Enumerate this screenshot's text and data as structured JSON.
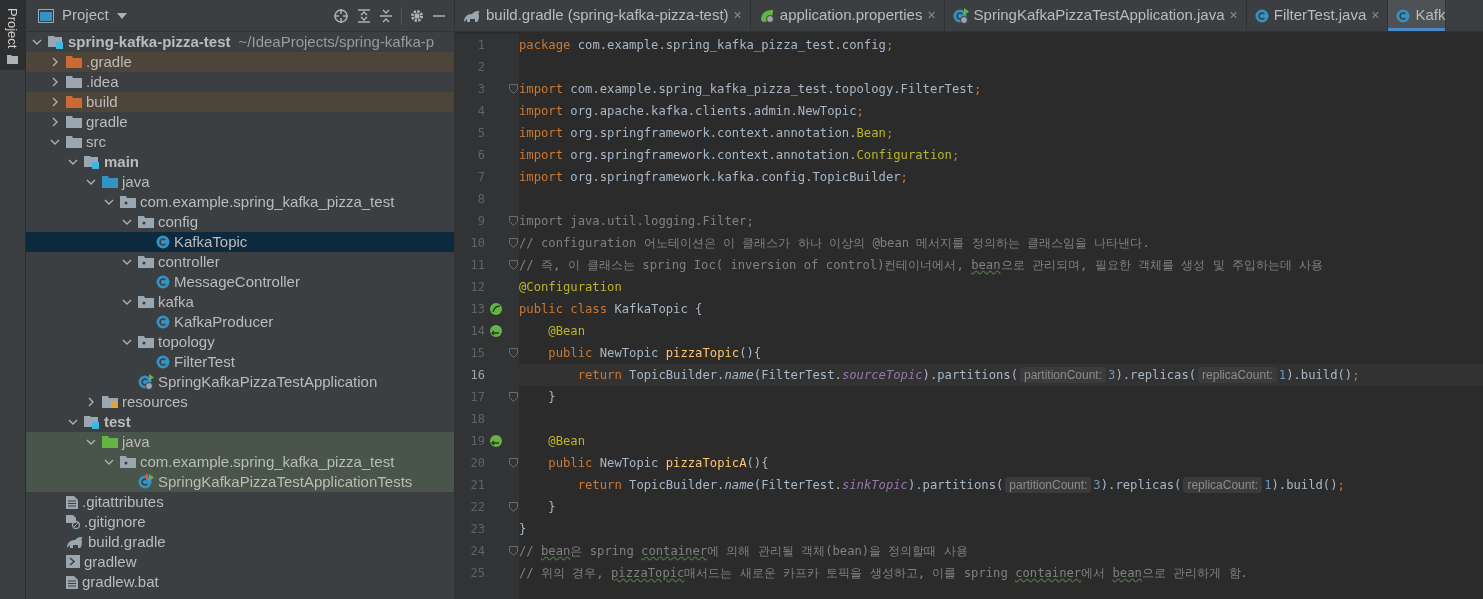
{
  "side_strip": {
    "label": "Project"
  },
  "project_panel": {
    "title": "Project",
    "tree": [
      {
        "label": "spring-kafka-pizza-test",
        "path": "~/IdeaProjects/spring-kafka-p",
        "kind": "module",
        "bold": true,
        "expanded": true,
        "selected": false,
        "children": [
          {
            "label": ".gradle",
            "kind": "excluded-folder",
            "expanded": false,
            "selected": false
          },
          {
            "label": ".idea",
            "kind": "folder",
            "expanded": false,
            "selected": false
          },
          {
            "label": "build",
            "kind": "excluded-folder",
            "expanded": false,
            "selected": false
          },
          {
            "label": "gradle",
            "kind": "folder",
            "expanded": false,
            "selected": false
          },
          {
            "label": "src",
            "kind": "folder",
            "expanded": true,
            "selected": false,
            "children": [
              {
                "label": "main",
                "kind": "module",
                "bold": true,
                "expanded": true,
                "selected": false,
                "children": [
                  {
                    "label": "java",
                    "kind": "source-folder",
                    "expanded": true,
                    "selected": false,
                    "children": [
                      {
                        "label": "com.example.spring_kafka_pizza_test",
                        "kind": "package",
                        "expanded": true,
                        "selected": false,
                        "children": [
                          {
                            "label": "config",
                            "kind": "package",
                            "expanded": true,
                            "selected": false,
                            "children": [
                              {
                                "label": "KafkaTopic",
                                "kind": "class",
                                "selected": true
                              }
                            ]
                          },
                          {
                            "label": "controller",
                            "kind": "package",
                            "expanded": true,
                            "selected": false,
                            "children": [
                              {
                                "label": "MessageController",
                                "kind": "class",
                                "selected": false
                              }
                            ]
                          },
                          {
                            "label": "kafka",
                            "kind": "package",
                            "expanded": true,
                            "selected": false,
                            "children": [
                              {
                                "label": "KafkaProducer",
                                "kind": "class",
                                "selected": false
                              }
                            ]
                          },
                          {
                            "label": "topology",
                            "kind": "package",
                            "expanded": true,
                            "selected": false,
                            "children": [
                              {
                                "label": "FilterTest",
                                "kind": "class",
                                "selected": false
                              }
                            ]
                          },
                          {
                            "label": "SpringKafkaPizzaTestApplication",
                            "kind": "application",
                            "selected": false
                          }
                        ]
                      }
                    ]
                  },
                  {
                    "label": "resources",
                    "kind": "resources",
                    "expanded": false,
                    "selected": false
                  }
                ]
              },
              {
                "label": "test",
                "kind": "module",
                "bold": true,
                "expanded": true,
                "selected": false,
                "children": [
                  {
                    "label": "java",
                    "kind": "test-folder",
                    "expanded": true,
                    "selected": false,
                    "children": [
                      {
                        "label": "com.example.spring_kafka_pizza_test",
                        "kind": "test-package",
                        "expanded": true,
                        "selected": false,
                        "children": [
                          {
                            "label": "SpringKafkaPizzaTestApplicationTests",
                            "kind": "test-class",
                            "selected": false
                          }
                        ]
                      }
                    ]
                  }
                ]
              }
            ]
          },
          {
            "label": ".gitattributes",
            "kind": "file",
            "selected": false
          },
          {
            "label": ".gitignore",
            "kind": "ignore-file",
            "selected": false
          },
          {
            "label": "build.gradle",
            "kind": "gradle",
            "selected": false
          },
          {
            "label": "gradlew",
            "kind": "shell",
            "selected": false
          },
          {
            "label": "gradlew.bat",
            "kind": "file",
            "selected": false
          }
        ]
      }
    ]
  },
  "tabs": [
    {
      "label": "build.gradle (spring-kafka-pizza-test)",
      "kind": "gradle",
      "close": "×",
      "selected": false
    },
    {
      "label": "application.properties",
      "kind": "properties",
      "close": "×",
      "selected": false
    },
    {
      "label": "SpringKafkaPizzaTestApplication.java",
      "kind": "application",
      "close": "×",
      "selected": false
    },
    {
      "label": "FilterTest.java",
      "kind": "class",
      "close": "×",
      "selected": false
    },
    {
      "label": "Kafk",
      "kind": "class",
      "selected": true
    }
  ],
  "editor": {
    "lines": [
      {
        "number": "1",
        "tokens": [
          {
            "kind": "keyword",
            "text": "package"
          },
          {
            "kind": "plain",
            "text": " com.example.spring_kafka_pizza_test.config"
          },
          {
            "kind": "keyword",
            "text": ";"
          }
        ]
      },
      {
        "number": "2"
      },
      {
        "number": "3",
        "fold": true,
        "tokens": [
          {
            "kind": "keyword",
            "text": "import"
          },
          {
            "kind": "plain",
            "text": " com.example.spring_kafka_pizza_test.topology.FilterTest"
          },
          {
            "kind": "keyword",
            "text": ";"
          }
        ]
      },
      {
        "number": "4",
        "tokens": [
          {
            "kind": "keyword",
            "text": "import"
          },
          {
            "kind": "plain",
            "text": " org.apache.kafka.clients.admin.NewTopic"
          },
          {
            "kind": "keyword",
            "text": ";"
          }
        ]
      },
      {
        "number": "5",
        "tokens": [
          {
            "kind": "keyword",
            "text": "import"
          },
          {
            "kind": "plain",
            "text": " org.springframework.context.annotation."
          },
          {
            "kind": "annotation",
            "text": "Bean"
          },
          {
            "kind": "keyword",
            "text": ";"
          }
        ]
      },
      {
        "number": "6",
        "tokens": [
          {
            "kind": "keyword",
            "text": "import"
          },
          {
            "kind": "plain",
            "text": " org.springframework.context.annotation."
          },
          {
            "kind": "annotation",
            "text": "Configuration"
          },
          {
            "kind": "keyword",
            "text": ";"
          }
        ]
      },
      {
        "number": "7",
        "tokens": [
          {
            "kind": "keyword",
            "text": "import"
          },
          {
            "kind": "plain",
            "text": " org.springframework.kafka.config.TopicBuilder"
          },
          {
            "kind": "keyword",
            "text": ";"
          }
        ]
      },
      {
        "number": "8"
      },
      {
        "number": "9",
        "fold": true,
        "tokens": [
          {
            "kind": "comment",
            "text": "import java.util.logging.Filter;"
          }
        ]
      },
      {
        "number": "10",
        "fold": true,
        "tokens": [
          {
            "kind": "comment",
            "text": "// configuration 어노테이션은 이 클래스가 하나 이상의 @bean 메서지를 정의하는 클래스임을 나타낸다."
          }
        ]
      },
      {
        "number": "11",
        "fold": true,
        "tokens": [
          {
            "kind": "comment",
            "text": "// 즉, 이 클래스는 spring Ioc( inversion of control)컨테이너에서, "
          },
          {
            "kind": "typo",
            "text": "bean"
          },
          {
            "kind": "comment",
            "text": "으로 관리되며, 필요한 객체를 생성 및 주입하는데 사용"
          }
        ]
      },
      {
        "number": "12",
        "tokens": [
          {
            "kind": "annotation",
            "text": "@Configuration"
          }
        ]
      },
      {
        "number": "13",
        "gutter": {
          "kind": "bean"
        },
        "tokens": [
          {
            "kind": "keyword",
            "text": "public class "
          },
          {
            "kind": "plain",
            "text": "KafkaTopic {"
          }
        ]
      },
      {
        "number": "14",
        "gutter": {
          "kind": "bean-link"
        },
        "tokens": [
          {
            "kind": "annotation",
            "text": "    @Bean"
          }
        ]
      },
      {
        "number": "15",
        "fold": true,
        "tokens": [
          {
            "kind": "keyword",
            "text": "    public "
          },
          {
            "kind": "plain",
            "text": "NewTopic "
          },
          {
            "kind": "method",
            "text": "pizzaTopic"
          },
          {
            "kind": "plain",
            "text": "(){"
          }
        ]
      },
      {
        "number": "16",
        "current": true,
        "tokens": [
          {
            "kind": "keyword",
            "text": "        return "
          },
          {
            "kind": "plain",
            "text": "TopicBuilder."
          },
          {
            "kind": "italic",
            "text": "name"
          },
          {
            "kind": "plain",
            "text": "(FilterTest."
          },
          {
            "kind": "static",
            "text": "sourceTopic"
          },
          {
            "kind": "plain",
            "text": ").partitions("
          },
          {
            "kind": "hint",
            "text": "partitionCount:"
          },
          {
            "kind": "number",
            "text": "3"
          },
          {
            "kind": "plain",
            "text": ").replicas("
          },
          {
            "kind": "hint",
            "text": "replicaCount:"
          },
          {
            "kind": "number",
            "text": "1"
          },
          {
            "kind": "plain",
            "text": ").build()"
          },
          {
            "kind": "keyword",
            "text": ";"
          }
        ]
      },
      {
        "number": "17",
        "fold": true,
        "tokens": [
          {
            "kind": "plain",
            "text": "    }"
          }
        ]
      },
      {
        "number": "18"
      },
      {
        "number": "19",
        "gutter": {
          "kind": "bean-link"
        },
        "tokens": [
          {
            "kind": "annotation",
            "text": "    @Bean"
          }
        ]
      },
      {
        "number": "20",
        "fold": true,
        "tokens": [
          {
            "kind": "keyword",
            "text": "    public "
          },
          {
            "kind": "plain",
            "text": "NewTopic "
          },
          {
            "kind": "method",
            "text": "pizzaTopicA"
          },
          {
            "kind": "plain",
            "text": "(){"
          }
        ]
      },
      {
        "number": "21",
        "tokens": [
          {
            "kind": "keyword",
            "text": "        return "
          },
          {
            "kind": "plain",
            "text": "TopicBuilder."
          },
          {
            "kind": "italic",
            "text": "name"
          },
          {
            "kind": "plain",
            "text": "(FilterTest."
          },
          {
            "kind": "static",
            "text": "sinkTopic"
          },
          {
            "kind": "plain",
            "text": ").partitions("
          },
          {
            "kind": "hint",
            "text": "partitionCount:"
          },
          {
            "kind": "number",
            "text": "3"
          },
          {
            "kind": "plain",
            "text": ").replicas("
          },
          {
            "kind": "hint",
            "text": "replicaCount:"
          },
          {
            "kind": "number",
            "text": "1"
          },
          {
            "kind": "plain",
            "text": ").build()"
          },
          {
            "kind": "keyword",
            "text": ";"
          }
        ]
      },
      {
        "number": "22",
        "fold": true,
        "tokens": [
          {
            "kind": "plain",
            "text": "    }"
          }
        ]
      },
      {
        "number": "23",
        "tokens": [
          {
            "kind": "plain",
            "text": "}"
          }
        ]
      },
      {
        "number": "24",
        "fold": true,
        "tokens": [
          {
            "kind": "comment",
            "text": "// "
          },
          {
            "kind": "typo",
            "text": "bean"
          },
          {
            "kind": "comment",
            "text": "은 spring "
          },
          {
            "kind": "typo",
            "text": "container"
          },
          {
            "kind": "comment",
            "text": "에 의해 관리될 객체(bean)을 정의할때 사용"
          }
        ]
      },
      {
        "number": "25",
        "tokens": [
          {
            "kind": "comment",
            "text": "// 위의 경우, "
          },
          {
            "kind": "typo",
            "text": "pizzaTopic"
          },
          {
            "kind": "comment",
            "text": "매서드는 새로운 카프카 토픽을 생성하고, 이를 spring "
          },
          {
            "kind": "typo",
            "text": "container"
          },
          {
            "kind": "comment",
            "text": "에서 "
          },
          {
            "kind": "typo",
            "text": "bean"
          },
          {
            "kind": "comment",
            "text": "으로 관리하게 함."
          }
        ]
      }
    ]
  }
}
